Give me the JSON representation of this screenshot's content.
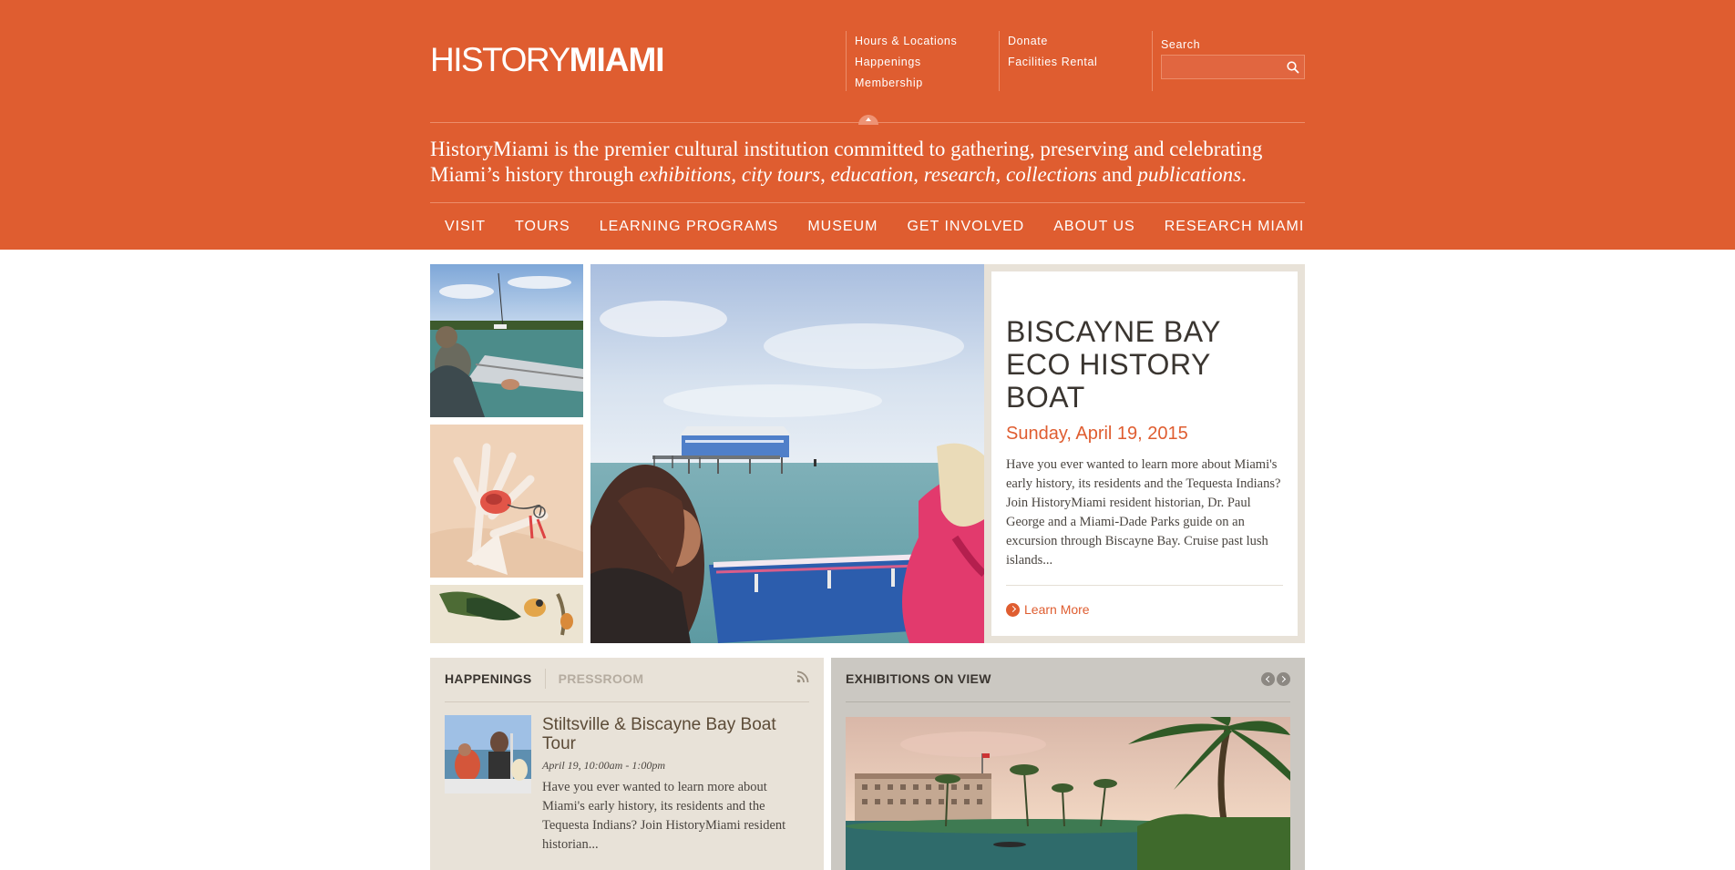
{
  "header": {
    "logo_light": "HISTORY",
    "logo_bold": "MIAMI",
    "utility_links_col1": [
      "Hours & Locations",
      "Happenings",
      "Membership"
    ],
    "utility_links_col2": [
      "Donate",
      "Facilities Rental"
    ],
    "search": {
      "label": "Search",
      "placeholder": ""
    },
    "tagline": {
      "part1": "HistoryMiami is the premier cultural institution committed to gathering, preserving and celebrating Miami’s history through ",
      "em1": "exhibitions",
      "sep1": ", ",
      "em2": "city tours",
      "sep2": ", ",
      "em3": "education",
      "sep3": ", ",
      "em4": "research",
      "sep4": ", ",
      "em5": "collections",
      "sep5": " and ",
      "em6": "publications",
      "end": "."
    },
    "nav": [
      "VISIT",
      "TOURS",
      "LEARNING PROGRAMS",
      "MUSEUM",
      "GET INVOLVED",
      "ABOUT US",
      "RESEARCH MIAMI"
    ]
  },
  "feature": {
    "title": "BISCAYNE BAY ECO HISTORY BOAT",
    "date": "Sunday, April 19, 2015",
    "description": "Have you ever wanted to learn more about Miami's early history, its residents and the Tequesta Indians? Join HistoryMiami resident historian, Dr. Paul George and a Miami-Dade Parks guide on an excursion through Biscayne Bay. Cruise past lush islands...",
    "cta": "Learn More"
  },
  "happenings": {
    "tab_active": "HAPPENINGS",
    "tab_inactive": "PRESSROOM",
    "event": {
      "title": "Stiltsville & Biscayne Bay Boat Tour",
      "time": "April 19, 10:00am - 1:00pm",
      "description": "Have you ever wanted to learn more about Miami's early history, its residents and the Tequesta Indians? Join HistoryMiami resident historian..."
    }
  },
  "exhibitions": {
    "title": "EXHIBITIONS ON VIEW"
  },
  "colors": {
    "brand_orange": "#df5d30",
    "panel_beige": "#e8e2d8",
    "panel_gray": "#cbc8c2"
  }
}
